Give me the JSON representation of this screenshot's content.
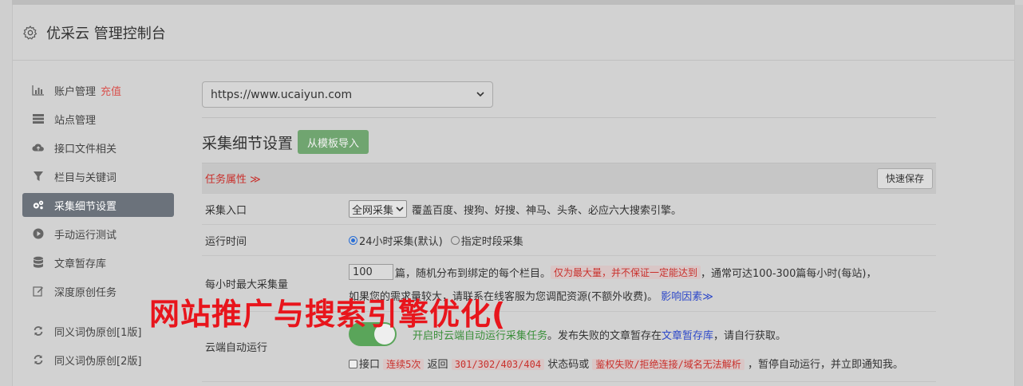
{
  "header": {
    "title": "优采云 管理控制台"
  },
  "sidebar": {
    "items": [
      {
        "label": "账户管理",
        "extra": "充值",
        "icon": "bar-chart-icon"
      },
      {
        "label": "站点管理",
        "icon": "list-icon"
      },
      {
        "label": "接口文件相关",
        "icon": "cloud-upload-icon"
      },
      {
        "label": "栏目与关键词",
        "icon": "filter-icon"
      },
      {
        "label": "采集细节设置",
        "icon": "gears-icon",
        "active": true
      },
      {
        "label": "手动运行测试",
        "icon": "play-icon"
      },
      {
        "label": "文章暂存库",
        "icon": "database-icon"
      },
      {
        "label": "深度原创任务",
        "icon": "edit-icon"
      },
      {
        "label": "同义词伪原创[1版]",
        "icon": "refresh-icon"
      },
      {
        "label": "同义词伪原创[2版]",
        "icon": "refresh-icon"
      }
    ]
  },
  "main": {
    "site_select": "https://www.ucaiyun.com",
    "section_title": "采集细节设置",
    "import_button": "从模板导入",
    "task_attr_label": "任务属性 ≫",
    "quick_save": "快速保存",
    "rows": {
      "entry": {
        "label": "采集入口",
        "select": "全网采集",
        "desc": "覆盖百度、搜狗、好搜、神马、头条、必应六大搜索引擎。"
      },
      "runtime": {
        "label": "运行时间",
        "opt1": "24小时采集(默认)",
        "opt2": "指定时段采集"
      },
      "max_per_hour": {
        "label": "每小时最大采集量",
        "value": "100",
        "text1": "篇，随机分布到绑定的每个栏目。",
        "highlight": "仅为最大量，并不保证一定能达到",
        "text2": "，通常可达100-300篇每小时(每站)，",
        "text3": "如果您的需求量较大，请联系在线客服为您调配资源(不额外收费)。",
        "link": "影响因素≫"
      },
      "cloud_auto": {
        "label": "云端自动运行",
        "green_text": "开启时云端自动运行采集任务",
        "text1": "。发布失败的文章暂存在",
        "link": "文章暂存库",
        "text2": "，请自行获取。",
        "chk_label": "接口",
        "hl1": "连续5次",
        "text3": "返回",
        "hl2": "301/302/403/404",
        "text4": "状态码或",
        "hl3": "鉴权失败/拒绝连接/域名无法解析",
        "text5": "，暂停自动运行，并立即通知我。"
      }
    }
  },
  "watermark": "网站推广与搜索引擎优化(",
  "colors": {
    "active_bg": "#6b727b",
    "accent_red": "#c9302c",
    "green": "#5cb85c",
    "watermark": "#e8151c"
  }
}
